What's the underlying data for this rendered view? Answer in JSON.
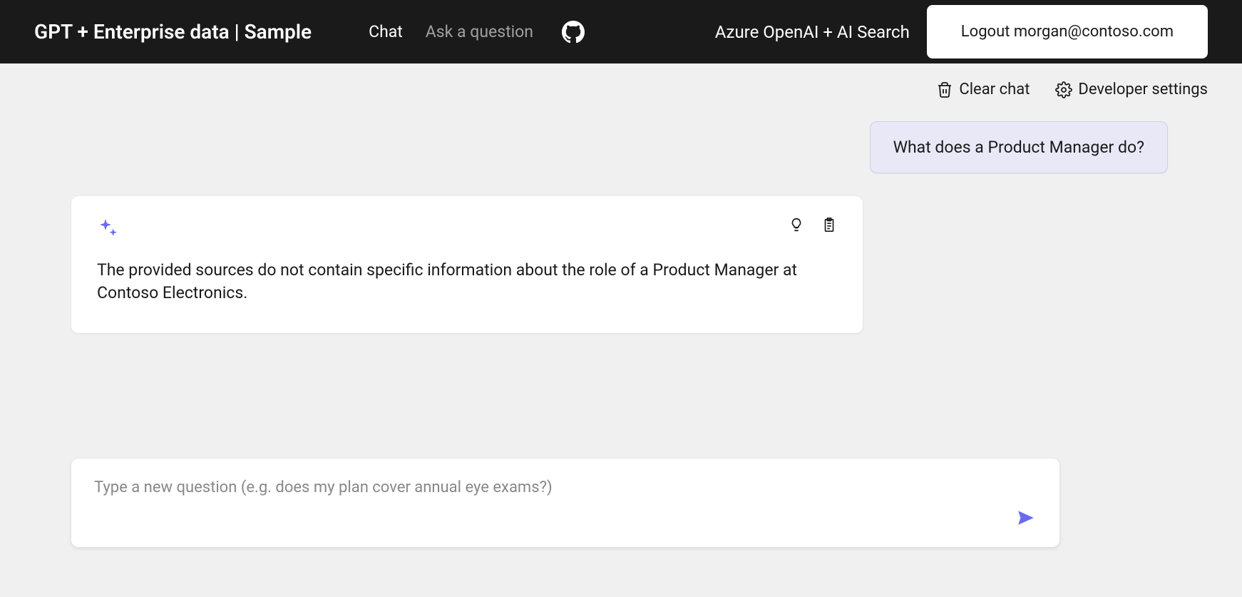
{
  "header": {
    "title": "GPT + Enterprise data | Sample",
    "nav": {
      "chat": "Chat",
      "ask": "Ask a question"
    },
    "right_text": "Azure OpenAI + AI Search",
    "logout_label": "Logout morgan@contoso.com"
  },
  "toolbar": {
    "clear_chat": "Clear chat",
    "developer_settings": "Developer settings"
  },
  "messages": {
    "user_0": "What does a Product Manager do?",
    "assistant_0": "The provided sources do not contain specific information about the role of a Product Manager at Contoso Electronics."
  },
  "input": {
    "placeholder": "Type a new question (e.g. does my plan cover annual eye exams?)",
    "value": ""
  }
}
